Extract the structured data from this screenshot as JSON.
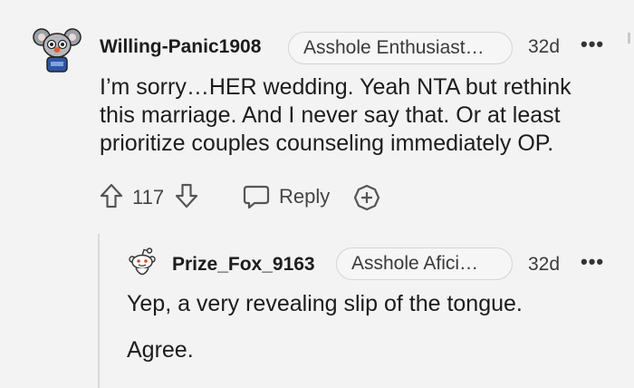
{
  "comment": {
    "username": "Willing-Panic1908",
    "flair": "Asshole Enthusiast…",
    "age": "32d",
    "more": "•••",
    "body": "I’m sorry…HER wedding. Yeah NTA but rethink this marriage. And I never say that. Or at least prioritize couples counseling immediately OP.",
    "votes": "117",
    "reply_label": "Reply",
    "avatar_icon": "koala-avatar-icon"
  },
  "reply": {
    "username": "Prize_Fox_9163",
    "flair": "Asshole Afici…",
    "age": "32d",
    "more": "•••",
    "line1": "Yep, a very revealing slip of the tongue.",
    "line2": "Agree.",
    "avatar_icon": "snoo-avatar-icon"
  }
}
